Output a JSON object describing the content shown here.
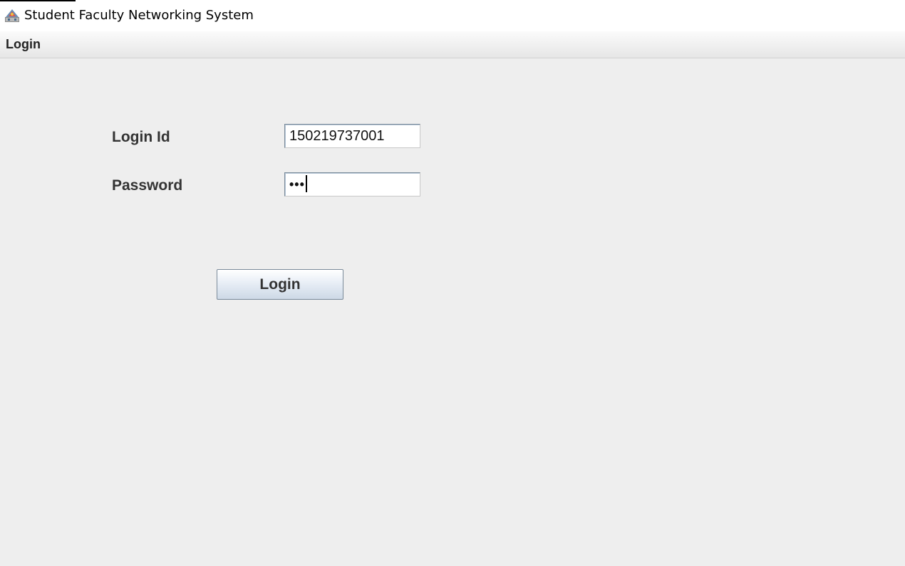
{
  "window": {
    "title": "Student Faculty Networking System",
    "icon": "java-app-icon"
  },
  "menubar": {
    "items": [
      {
        "label": "Login"
      }
    ]
  },
  "form": {
    "login_id": {
      "label": "Login Id",
      "value": "150219737001"
    },
    "password": {
      "label": "Password",
      "masked_value": "•••"
    },
    "submit_label": "Login"
  },
  "colors": {
    "content_background": "#eeeeee",
    "menubar_background": "#efefef",
    "button_gradient_bottom": "#cdd9e6"
  }
}
